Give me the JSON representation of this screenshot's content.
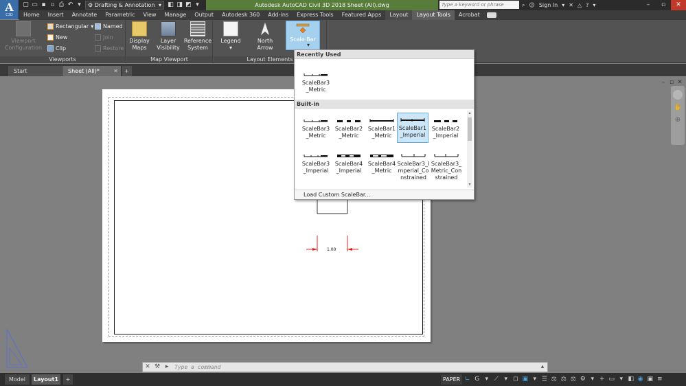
{
  "app": {
    "badge": "A",
    "badge_sub": "C3D",
    "title": "Autodesk AutoCAD Civil 3D 2018    Sheet (All).dwg",
    "workspace": "Drafting & Annotation",
    "search_placeholder": "Type a keyword or phrase",
    "sign_in": "Sign In"
  },
  "ribbon_tabs": [
    "Home",
    "Insert",
    "Annotate",
    "Parametric",
    "View",
    "Manage",
    "Output",
    "Autodesk 360",
    "Add-ins",
    "Express Tools",
    "Featured Apps",
    "Layout",
    "Layout Tools",
    "Acrobat"
  ],
  "ribbon": {
    "viewports": {
      "title": "Viewports",
      "viewport_config": "Viewport Configuration",
      "rectangular": "Rectangular",
      "new": "New",
      "clip": "Clip",
      "named": "Named",
      "join": "Join",
      "restore": "Restore"
    },
    "map_viewport": {
      "title": "Map Viewport",
      "display_maps": "Display Maps",
      "layer_visibility": "Layer Visibility",
      "reference_system": "Reference System"
    },
    "layout_elements": {
      "title": "Layout Elements",
      "legend": "Legend",
      "north_arrow": "North Arrow",
      "scale_bar": "Scale Bar"
    }
  },
  "doc_tabs": [
    "Start",
    "Sheet (All)*"
  ],
  "gallery": {
    "recent_header": "Recently Used",
    "builtin_header": "Built-in",
    "recent": [
      "ScaleBar3_Metric"
    ],
    "builtin": [
      "ScaleBar3_Metric",
      "ScaleBar2_Metric",
      "ScaleBar1_Metric",
      "ScaleBar1_Imperial",
      "ScaleBar2_Imperial",
      "ScaleBar3_Imperial",
      "ScaleBar4_Imperial",
      "ScaleBar4_Metric",
      "ScaleBar3_Imperial_Constrained",
      "ScaleBar3_Metric_Constrained"
    ],
    "selected": "ScaleBar1_Imperial",
    "footer": "Load Custom ScaleBar..."
  },
  "drawing": {
    "dimension_value": "1.00"
  },
  "command_line": {
    "placeholder": "Type a command"
  },
  "status": {
    "model_tab": "Model",
    "layout_tab": "Layout1",
    "paper": "PAPER"
  }
}
